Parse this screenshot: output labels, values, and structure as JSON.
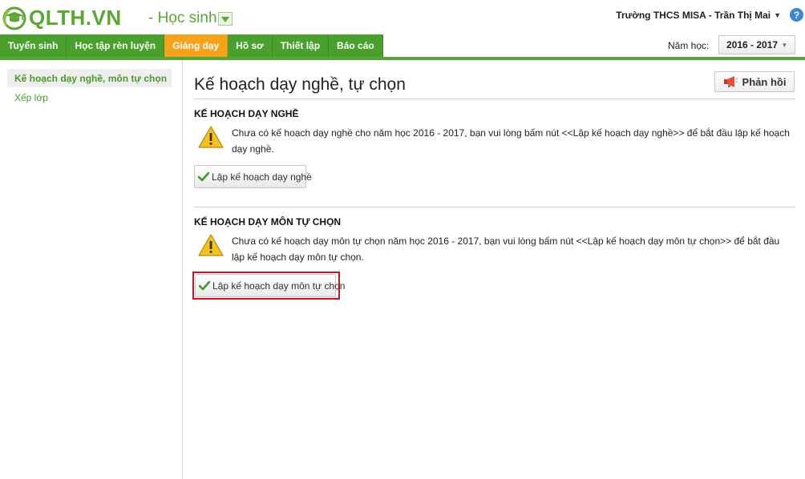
{
  "header": {
    "logo_text": "QLTH.VN",
    "app_name": "- Học sinh",
    "user_label": "Trường THCS MISA - Trần Thị Mai",
    "help_symbol": "?"
  },
  "nav": {
    "tabs": [
      {
        "label": "Tuyển sinh",
        "active": false
      },
      {
        "label": "Học tập rèn luyện",
        "active": false
      },
      {
        "label": "Giảng dạy",
        "active": true
      },
      {
        "label": "Hồ sơ",
        "active": false
      },
      {
        "label": "Thiết lập",
        "active": false
      },
      {
        "label": "Báo cáo",
        "active": false
      }
    ],
    "year_label": "Năm học:",
    "year_value": "2016 - 2017"
  },
  "sidebar": {
    "items": [
      {
        "label": "Kế hoạch dạy nghề, môn tự chọn",
        "active": true
      },
      {
        "label": "Xếp lớp",
        "active": false
      }
    ]
  },
  "main": {
    "title": "Kế hoạch dạy nghề, tự chọn",
    "feedback_label": "Phản hồi",
    "sections": [
      {
        "title": "KẾ HOẠCH DẠY NGHỀ",
        "message": "Chưa có kế hoạch dạy nghề cho năm học 2016 - 2017, bạn vui lòng bấm nút <<Lập kế hoạch dạy nghề>> để bắt đầu lập kế hoạch dạy nghề.",
        "button_label": "Lập kế hoạch dạy nghề"
      },
      {
        "title": "KẾ HOẠCH DẠY MÔN TỰ CHỌN",
        "message": "Chưa có kế hoạch dạy môn tự chọn năm học 2016 - 2017, bạn vui lòng bấm nút <<Lập kế hoạch dạy môn tự chọn>> để bắt đầu lập kế hoạch dạy môn tự chọn.",
        "button_label": "Lập kế hoạch dạy môn tự chọn"
      }
    ]
  },
  "colors": {
    "brand_green": "#5aa832",
    "nav_green": "#4aa02c",
    "active_tab": "#f7a21b",
    "highlight": "#c4161c",
    "warning": "#f5c21b"
  },
  "icons": [
    "logo-icon",
    "dropdown-arrow-icon",
    "caret-down-icon",
    "help-icon",
    "chevron-down-icon",
    "megaphone-icon",
    "warning-icon",
    "check-icon"
  ]
}
